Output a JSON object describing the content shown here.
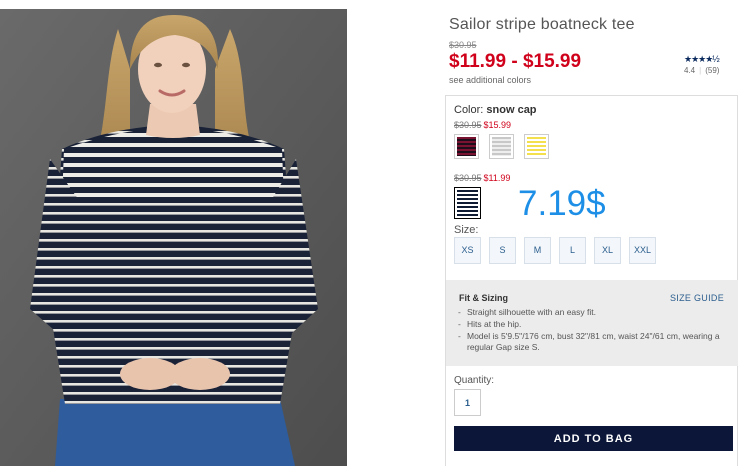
{
  "product": {
    "title": "Sailor stripe boatneck tee",
    "was_price": "$30.95",
    "sale_range": "$11.99 - $15.99",
    "see_colors": "see additional colors",
    "rating": {
      "stars": "★★★★½",
      "score": "4.4",
      "reviews": "(59)"
    }
  },
  "color": {
    "label": "Color:",
    "selected_name": "snow cap",
    "groups": [
      {
        "old_price": "$30.95",
        "new_price": "$15.99",
        "swatches": [
          {
            "name": "burgundy stripe"
          },
          {
            "name": "grey stripe"
          },
          {
            "name": "yellow stripe"
          }
        ]
      },
      {
        "old_price": "$30.95",
        "new_price": "$11.99",
        "swatches": [
          {
            "name": "snow cap"
          }
        ]
      }
    ]
  },
  "overlay_price": "7.19$",
  "size": {
    "label": "Size:",
    "options": [
      "XS",
      "S",
      "M",
      "L",
      "XL",
      "XXL"
    ]
  },
  "fit": {
    "title": "Fit & Sizing",
    "size_guide": "SIZE GUIDE",
    "bullets": [
      "Straight silhouette with an easy fit.",
      "Hits at the hip.",
      "Model is 5'9.5\"/176 cm, bust 32\"/81 cm, waist 24\"/61 cm, wearing a regular Gap size S."
    ]
  },
  "quantity": {
    "label": "Quantity:",
    "value": "1"
  },
  "cta": {
    "add_to_bag": "ADD TO BAG"
  },
  "colors": {
    "sale_red": "#d0021b",
    "navy": "#0b1638",
    "link_blue": "#2b5e8e",
    "overlay_blue": "#1e8fe6"
  }
}
